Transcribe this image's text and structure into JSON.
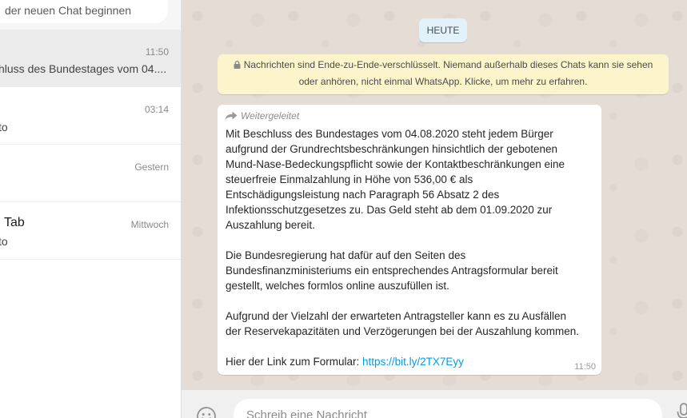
{
  "sidebar": {
    "search_placeholder": "der neuen Chat beginnen",
    "chats": [
      {
        "time": "11:50",
        "name": "",
        "preview": "hluss des Bundestages vom 04...."
      },
      {
        "time": "03:14",
        "name": "",
        "preview": "to"
      },
      {
        "time": "Gestern",
        "name": "",
        "preview": ""
      },
      {
        "time": "Mittwoch",
        "name": "Tab",
        "preview": "to"
      }
    ]
  },
  "conversation": {
    "date_chip": "HEUTE",
    "encryption_notice": {
      "icon": "lock-icon",
      "line1": "Nachrichten sind Ende-zu-Ende-verschlüsselt. Niemand außerhalb dieses Chats kann sie sehen",
      "line2": "oder anhören, nicht einmal WhatsApp. Klicke, um mehr zu erfahren."
    },
    "message": {
      "forwarded_icon": "forward-icon",
      "forwarded_label": "Weitergeleitet",
      "paragraphs": [
        "Mit Beschluss des Bundestages vom 04.08.2020 steht jedem Bürger\naufgrund der Grundrechtsbeschränkungen hinsichtlich der gebotenen\nMund-Nase-Bedeckungspflicht sowie der Kontaktbeschränkungen eine\nsteuerfreie Einmalzahlung in Höhe von 536,00 € als\nEntschädigungsleistung nach Paragraph 56 Absatz 2 des\nInfektionsschutzgesetzes zu. Das Geld steht ab dem 01.09.2020 zur\nAuszahlung bereit.",
        "Die Bundesregierung hat dafür auf den Seiten des\nBundesfinanzministeriums ein entsprechendes Antragsformular bereit\ngestellt, welches formlos online auszufüllen ist.",
        "Aufgrund der Vielzahl der erwarteten Antragsteller kann es zu Ausfällen\nder Reservekapazitäten und Verzögerungen bei der Auszahlung kommen."
      ],
      "link_prefix": "Hier der Link zum Formular: ",
      "link_text": "https://bit.ly/2TX7Eyy",
      "time": "11:50"
    },
    "footer": {
      "input_placeholder": "Schreib eine Nachricht",
      "emoji_icon": "emoji-icon",
      "mic_icon": "microphone-icon"
    },
    "colors": {
      "wallpaper": "#e5ddd5",
      "notice": "#fcf4cb",
      "date_chip": "#e1f2fb",
      "link": "#039be5"
    }
  }
}
